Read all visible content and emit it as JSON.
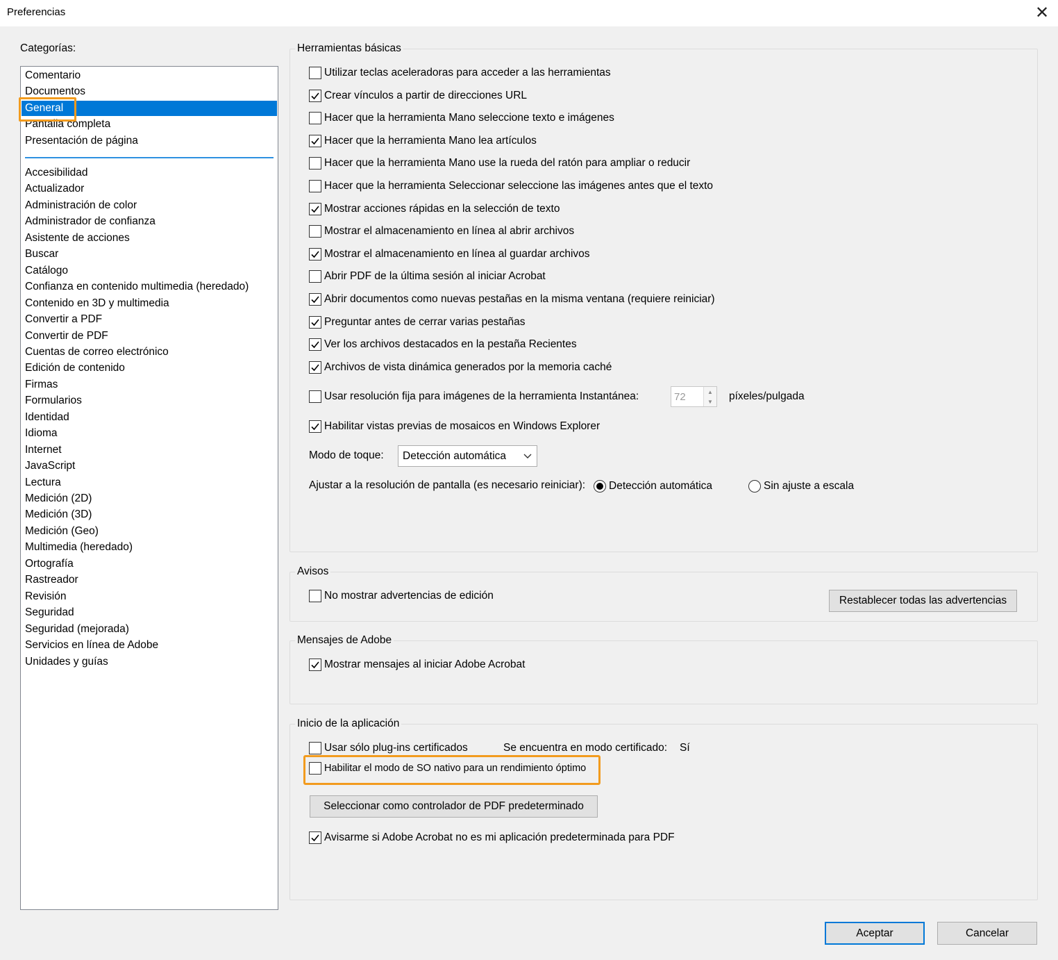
{
  "window": {
    "title": "Preferencias",
    "close_symbol": "✕"
  },
  "categories": {
    "label": "Categorías:",
    "top_items": [
      "Comentario",
      "Documentos",
      "General",
      "Pantalla completa",
      "Presentación de página"
    ],
    "selected": "General",
    "items": [
      "Accesibilidad",
      "Actualizador",
      "Administración de color",
      "Administrador de confianza",
      "Asistente de acciones",
      "Buscar",
      "Catálogo",
      "Confianza en contenido multimedia (heredado)",
      "Contenido en 3D y multimedia",
      "Convertir a PDF",
      "Convertir de PDF",
      "Cuentas de correo electrónico",
      "Edición de contenido",
      "Firmas",
      "Formularios",
      "Identidad",
      "Idioma",
      "Internet",
      "JavaScript",
      "Lectura",
      "Medición (2D)",
      "Medición (3D)",
      "Medición (Geo)",
      "Multimedia (heredado)",
      "Ortografía",
      "Rastreador",
      "Revisión",
      "Seguridad",
      "Seguridad (mejorada)",
      "Servicios en línea de Adobe",
      "Unidades y guías"
    ]
  },
  "basic_tools": {
    "title": "Herramientas básicas",
    "options": [
      {
        "label": "Utilizar teclas aceleradoras para acceder a las herramientas",
        "checked": false
      },
      {
        "label": "Crear vínculos a partir de direcciones URL",
        "checked": true
      },
      {
        "label": "Hacer que la herramienta Mano seleccione texto e imágenes",
        "checked": false
      },
      {
        "label": "Hacer que la herramienta Mano lea artículos",
        "checked": true
      },
      {
        "label": "Hacer que la herramienta Mano use la rueda del ratón para ampliar o reducir",
        "checked": false
      },
      {
        "label": "Hacer que la herramienta Seleccionar seleccione las imágenes antes que el texto",
        "checked": false
      },
      {
        "label": "Mostrar acciones rápidas en la selección de texto",
        "checked": true
      },
      {
        "label": "Mostrar el almacenamiento en línea al abrir archivos",
        "checked": false
      },
      {
        "label": "Mostrar el almacenamiento en línea al guardar archivos",
        "checked": true
      },
      {
        "label": "Abrir PDF de la última sesión al iniciar Acrobat",
        "checked": false
      },
      {
        "label": "Abrir documentos como nuevas pestañas en la misma ventana (requiere reiniciar)",
        "checked": true
      },
      {
        "label": "Preguntar antes de cerrar varias pestañas",
        "checked": true
      },
      {
        "label": "Ver los archivos destacados en la pestaña Recientes",
        "checked": true
      },
      {
        "label": "Archivos de vista dinámica generados por la memoria caché",
        "checked": true
      }
    ],
    "fixed_resolution": {
      "label": "Usar resolución fija para imágenes de la herramienta Instantánea:",
      "checked": false,
      "value": "72",
      "unit": "píxeles/pulgada"
    },
    "thumbnails": {
      "label": "Habilitar vistas previas de mosaicos en Windows Explorer",
      "checked": true
    },
    "touch_mode": {
      "label": "Modo de toque:",
      "value": "Detección automática"
    },
    "screen_scaling": {
      "label": "Ajustar a la resolución de pantalla (es necesario reiniciar):",
      "option_auto": "Detección automática",
      "option_none": "Sin ajuste a escala",
      "selected": "auto"
    }
  },
  "warnings": {
    "title": "Avisos",
    "no_edit_warnings": {
      "label": "No mostrar advertencias de edición",
      "checked": false
    },
    "reset_button": "Restablecer todas las advertencias"
  },
  "adobe_messages": {
    "title": "Mensajes de Adobe",
    "show_messages": {
      "label": "Mostrar mensajes al iniciar Adobe Acrobat",
      "checked": true
    }
  },
  "startup": {
    "title": "Inicio de la aplicación",
    "certified_plugins": {
      "label": "Usar sólo plug-ins certificados",
      "checked": false
    },
    "certified_mode": {
      "label": "Se encuentra en modo certificado:",
      "value": "Sí"
    },
    "native_os_mode": {
      "label": "Habilitar el modo de SO nativo para un rendimiento óptimo",
      "checked": false
    },
    "default_pdf_button": "Seleccionar como controlador de PDF predeterminado",
    "notify_default": {
      "label": "Avisarme si Adobe Acrobat no es mi aplicación predeterminada para PDF",
      "checked": true
    }
  },
  "footer": {
    "ok": "Aceptar",
    "cancel": "Cancelar"
  },
  "colors": {
    "accent": "#0078d7",
    "highlight": "#f29b1e"
  }
}
